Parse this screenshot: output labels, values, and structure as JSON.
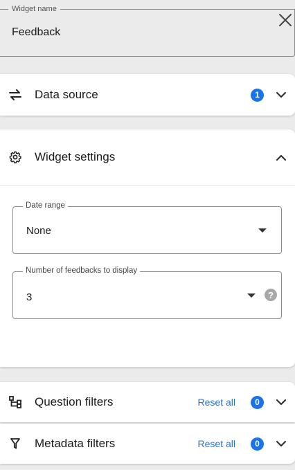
{
  "widget_name": {
    "legend": "Widget name",
    "value": "Feedback"
  },
  "close_icon": "close-icon",
  "data_source": {
    "title": "Data source",
    "badge": "1",
    "expanded": false
  },
  "widget_settings": {
    "title": "Widget settings",
    "expanded": true,
    "date_range": {
      "legend": "Date range",
      "value": "None"
    },
    "feedback_count": {
      "legend": "Number of feedbacks to display",
      "value": "3"
    }
  },
  "question_filters": {
    "title": "Question filters",
    "reset_label": "Reset all",
    "badge": "0"
  },
  "metadata_filters": {
    "title": "Metadata filters",
    "reset_label": "Reset all",
    "badge": "0"
  },
  "colors": {
    "accent": "#1a73e8",
    "background": "#ebebeb"
  }
}
